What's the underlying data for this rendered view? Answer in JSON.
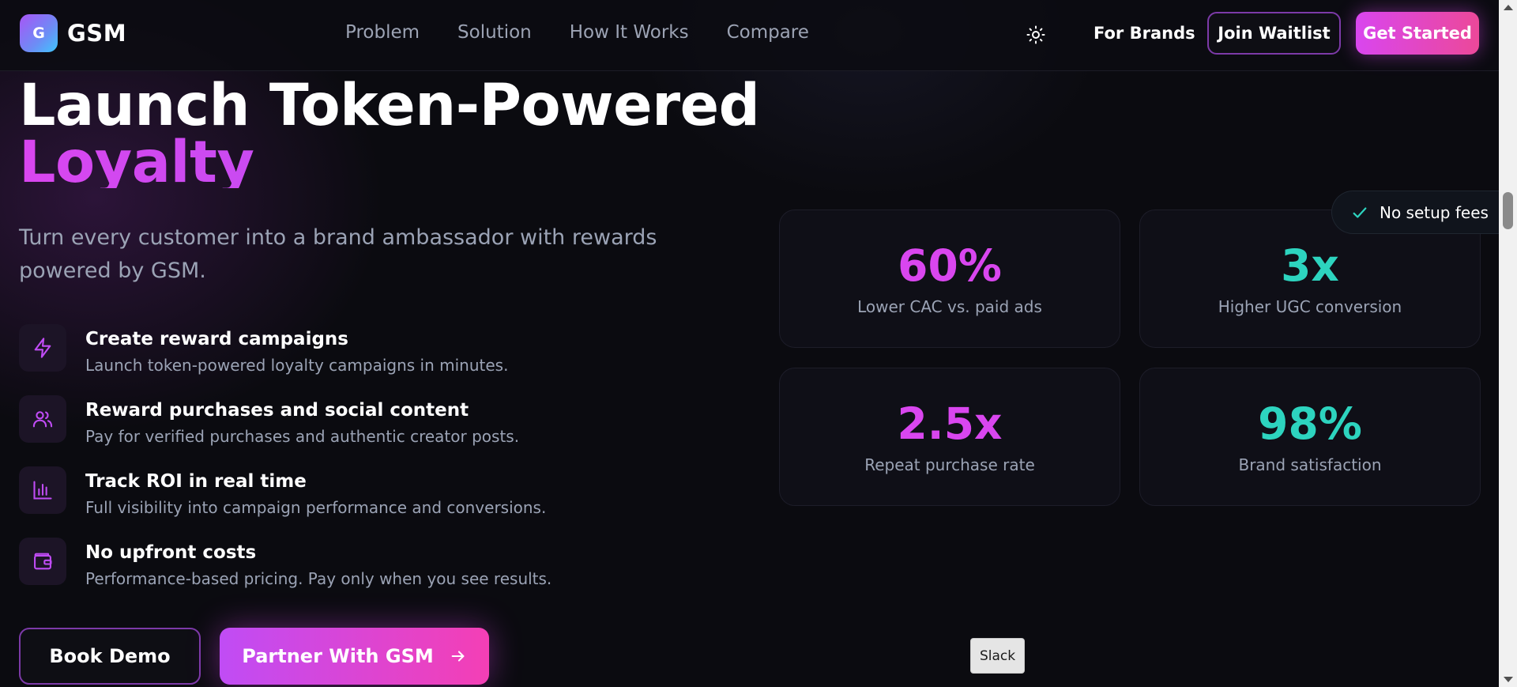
{
  "nav": {
    "logo_mark": "G",
    "logo_text": "GSM",
    "links": [
      "Problem",
      "Solution",
      "How It Works",
      "Compare"
    ],
    "theme_icon": "sun-icon",
    "for_brands": "For Brands",
    "join_waitlist": "Join Waitlist",
    "get_started": "Get Started"
  },
  "hero": {
    "headline_line1": "Launch Token-Powered",
    "headline_line2": "Loyalty",
    "subtitle": "Turn every customer into a brand ambassador with rewards powered by GSM.",
    "features": [
      {
        "icon": "lightning-icon",
        "title": "Create reward campaigns",
        "desc": "Launch token-powered loyalty campaigns in minutes."
      },
      {
        "icon": "users-icon",
        "title": "Reward purchases and social content",
        "desc": "Pay for verified purchases and authentic creator posts."
      },
      {
        "icon": "bar-chart-icon",
        "title": "Track ROI in real time",
        "desc": "Full visibility into campaign performance and conversions."
      },
      {
        "icon": "wallet-icon",
        "title": "No upfront costs",
        "desc": "Performance-based pricing. Pay only when you see results."
      }
    ],
    "book_demo": "Book Demo",
    "partner": "Partner With GSM"
  },
  "stats": [
    {
      "value": "60%",
      "label": "Lower CAC vs. paid ads",
      "color": "#d946ef"
    },
    {
      "value": "3x",
      "label": "Higher UGC conversion",
      "color": "#2dd4bf"
    },
    {
      "value": "2.5x",
      "label": "Repeat purchase rate",
      "color": "#d946ef"
    },
    {
      "value": "98%",
      "label": "Brand satisfaction",
      "color": "#2dd4bf"
    }
  ],
  "badge": {
    "icon": "check-icon",
    "text": "No setup fees"
  },
  "tooltip": {
    "text": "Slack"
  },
  "colors": {
    "accent": "#d946ef",
    "teal": "#2dd4bf",
    "background": "#0b0b10"
  }
}
